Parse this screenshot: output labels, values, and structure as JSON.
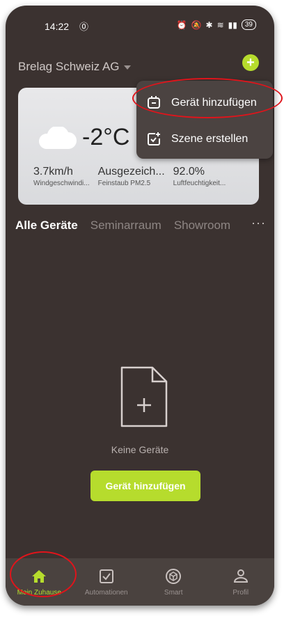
{
  "status_bar": {
    "time": "14:22",
    "sync_icon": "sync-circle-icon",
    "battery": "39"
  },
  "home": {
    "name": "Brelag Schweiz AG"
  },
  "weather": {
    "temperature": "-2°C",
    "stats": [
      {
        "value": "3.7km/h",
        "label": "Windgeschwindi..."
      },
      {
        "value": "Ausgezeich...",
        "label": "Feinstaub PM2.5"
      },
      {
        "value": "92.0%",
        "label": "Luftfeuchtigkeit..."
      }
    ]
  },
  "menu": {
    "items": [
      {
        "label": "Gerät hinzufügen",
        "icon": "device-add-icon"
      },
      {
        "label": "Szene erstellen",
        "icon": "scene-add-icon"
      }
    ]
  },
  "tabs": {
    "active": "Alle Geräte",
    "items": [
      "Seminarraum",
      "Showroom"
    ],
    "more": "···"
  },
  "empty": {
    "message": "Keine Geräte",
    "cta": "Gerät hinzufügen"
  },
  "nav": {
    "items": [
      {
        "label": "Mein Zuhause",
        "icon": "home-icon"
      },
      {
        "label": "Automationen",
        "icon": "checkbox-icon"
      },
      {
        "label": "Smart",
        "icon": "cube-icon"
      },
      {
        "label": "Profil",
        "icon": "person-icon"
      }
    ]
  },
  "colors": {
    "accent": "#b6dc2d",
    "background": "#3b3230",
    "annotation": "#e0141b"
  }
}
